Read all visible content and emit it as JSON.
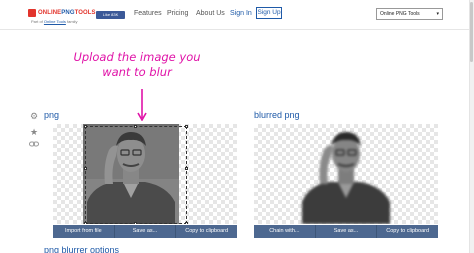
{
  "header": {
    "logo": {
      "part1": "ONLINE",
      "part2": "PNG",
      "part3": "TOOLS"
    },
    "family_prefix": "Part of",
    "family_link": "Online Tools",
    "family_suffix": "family",
    "fb_like": "Like 83K",
    "nav": [
      "Features",
      "Pricing",
      "About Us",
      "Sign In"
    ],
    "signup": "Sign Up",
    "tool_select": "Online PNG Tools"
  },
  "annotation": {
    "line1": "Upload the image you",
    "line2": "want to blur"
  },
  "input_panel": {
    "title": "png",
    "buttons": [
      "Import from file",
      "Save as...",
      "Copy to clipboard"
    ]
  },
  "output_panel": {
    "title": "blurred png",
    "buttons": [
      "Chain with...",
      "Save as...",
      "Copy to clipboard"
    ]
  },
  "options_heading": "png blurrer options",
  "colors": {
    "brand_red": "#e2342c",
    "link_blue": "#1f5aa8",
    "toolbar": "#4d6890",
    "annotation_pink": "#e014a8"
  },
  "icons": [
    "gear-icon",
    "star-icon",
    "link-icon"
  ]
}
